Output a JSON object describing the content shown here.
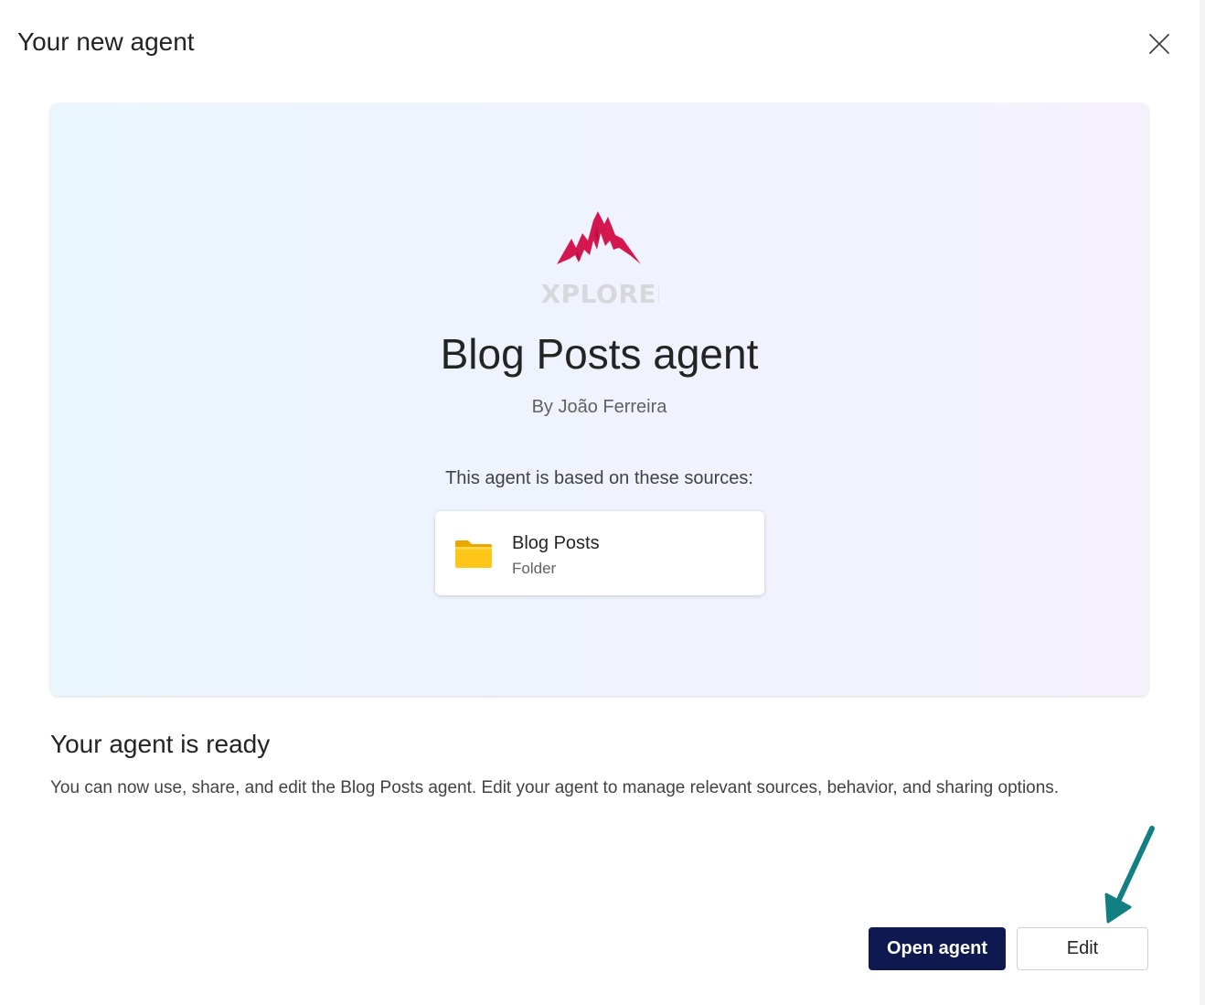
{
  "dialog": {
    "title": "Your new agent",
    "close_icon": "close-icon"
  },
  "hero": {
    "logo_text": "EXPLORER",
    "logo_color": "#d4184f",
    "agent_name": "Blog Posts agent",
    "author": "By João Ferreira",
    "sources_label": "This agent is based on these sources:",
    "sources": [
      {
        "title": "Blog Posts",
        "type": "Folder",
        "icon": "folder-icon"
      }
    ]
  },
  "ready": {
    "heading": "Your agent is ready",
    "description": "You can now use, share, and edit the Blog Posts agent. Edit your agent to manage relevant sources, behavior, and sharing options."
  },
  "actions": {
    "open_label": "Open agent",
    "edit_label": "Edit"
  },
  "colors": {
    "primary_button": "#0e1a4f",
    "annotation_arrow": "#127f82"
  }
}
